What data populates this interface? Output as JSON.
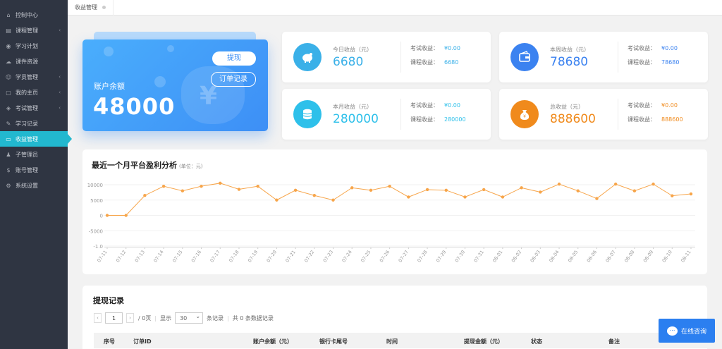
{
  "sidebar": {
    "items": [
      {
        "label": "控制中心",
        "icon": "home-icon",
        "chevron": false
      },
      {
        "label": "课程管理",
        "icon": "book-icon",
        "chevron": true
      },
      {
        "label": "学习计划",
        "icon": "eye-icon",
        "chevron": false
      },
      {
        "label": "课件资源",
        "icon": "cloud-icon",
        "chevron": false
      },
      {
        "label": "学员管理",
        "icon": "users-icon",
        "chevron": true
      },
      {
        "label": "我的主页",
        "icon": "document-icon",
        "chevron": true
      },
      {
        "label": "考试管理",
        "icon": "tag-icon",
        "chevron": true
      },
      {
        "label": "学习记录",
        "icon": "pencil-icon",
        "chevron": false
      },
      {
        "label": "收益管理",
        "icon": "card-icon",
        "chevron": false,
        "active": true
      },
      {
        "label": "子管理员",
        "icon": "user-icon",
        "chevron": false
      },
      {
        "label": "账号管理",
        "icon": "dollar-icon",
        "chevron": false
      },
      {
        "label": "系统设置",
        "icon": "gear-icon",
        "chevron": false
      }
    ]
  },
  "tabs": {
    "current": "收益管理"
  },
  "balance": {
    "label": "账户余额",
    "value": "48000",
    "withdraw_label": "提现",
    "orders_label": "订单记录"
  },
  "stats": [
    {
      "id": "today",
      "label": "今日收益（元）",
      "value": "6680",
      "exam_label": "考试收益：",
      "exam_value": "¥0.00",
      "course_label": "课程收益：",
      "course_value": "6680",
      "color": "#3ab0e8",
      "icon": "piggy-bank-icon"
    },
    {
      "id": "week",
      "label": "本周收益（元）",
      "value": "78680",
      "exam_label": "考试收益：",
      "exam_value": "¥0.00",
      "course_label": "课程收益：",
      "course_value": "78680",
      "color": "#3b82f0",
      "icon": "wallet-icon"
    },
    {
      "id": "month",
      "label": "本月收益（元）",
      "value": "280000",
      "exam_label": "考试收益：",
      "exam_value": "¥0.00",
      "course_label": "课程收益：",
      "course_value": "280000",
      "color": "#2ec0ea",
      "icon": "coins-icon"
    },
    {
      "id": "total",
      "label": "总收益（元）",
      "value": "888600",
      "exam_label": "考试收益：",
      "exam_value": "¥0.00",
      "course_label": "课程收益：",
      "course_value": "888600",
      "color": "#f08a1c",
      "icon": "money-bag-icon"
    }
  ],
  "chart_title": "最近一个月平台盈利分析",
  "chart_unit": "(单位：元)",
  "chart_data": {
    "type": "line",
    "categories": [
      "07-11",
      "07-12",
      "07-13",
      "07-14",
      "07-15",
      "07-16",
      "07-17",
      "07-18",
      "07-19",
      "07-20",
      "07-21",
      "07-22",
      "07-23",
      "07-24",
      "07-25",
      "07-26",
      "07-27",
      "07-28",
      "07-29",
      "07-30",
      "07-31",
      "08-01",
      "08-02",
      "08-03",
      "08-04",
      "08-05",
      "08-06",
      "08-07",
      "08-08",
      "08-09",
      "08-10",
      "08-11"
    ],
    "values": [
      0,
      0,
      6500,
      9500,
      8000,
      9500,
      10500,
      8500,
      9500,
      5000,
      8200,
      6500,
      5000,
      9000,
      8200,
      9500,
      6000,
      8400,
      8200,
      6000,
      8400,
      6000,
      9000,
      7600,
      10200,
      8000,
      5500,
      10200,
      8000,
      10200,
      6400,
      7000
    ],
    "yticks": [
      "10000",
      "5000",
      "0",
      "-5000",
      "-1.0"
    ],
    "ytick_values": [
      10000,
      5000,
      0,
      -5000,
      -10000
    ],
    "ylim": [
      -10000,
      10000
    ],
    "color": "#f7a54a",
    "grid": true
  },
  "record": {
    "title": "提现记录",
    "pager": {
      "prev": "‹",
      "next": "›",
      "page": "1",
      "total_pages": "/ 0页",
      "show": "显示",
      "size": "30",
      "per": "条记录",
      "total": "共 0 条数据记录"
    },
    "columns": [
      "序号",
      "订单ID",
      "账户余额（元）",
      "银行卡尾号",
      "时间",
      "提现金额（元）",
      "状态",
      "备注"
    ]
  },
  "chat": {
    "label": "在线咨询"
  }
}
